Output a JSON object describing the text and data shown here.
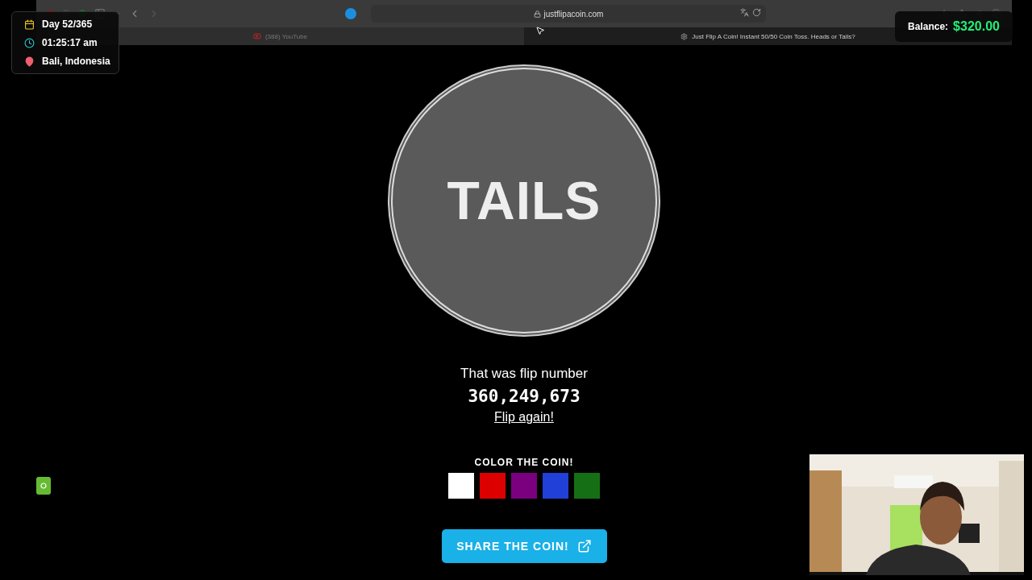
{
  "browser": {
    "url": "justflipacoin.com",
    "tabs": [
      {
        "title": "(388) YouTube",
        "selected": false
      },
      {
        "title": "Just Flip A Coin! Instant 50/50 Coin Toss. Heads or Tails?",
        "selected": true
      }
    ]
  },
  "coin": {
    "face": "TAILS"
  },
  "result": {
    "caption": "That was flip number",
    "number": "360,249,673",
    "link": "Flip again!"
  },
  "coin_colors": {
    "label": "COLOR THE COIN!",
    "swatches": [
      {
        "color": "#ffffff"
      },
      {
        "color": "#dd0000"
      },
      {
        "color": "#7a0080"
      },
      {
        "color": "#2040d8"
      },
      {
        "color": "#157015"
      }
    ]
  },
  "share_button": {
    "label": "SHARE THE COIN!"
  },
  "stream_overlay": {
    "stats": [
      {
        "kind": "day",
        "text": "Day 52/365"
      },
      {
        "kind": "time",
        "text": "01:25:17 am"
      },
      {
        "kind": "location",
        "text": "Bali, Indonesia"
      }
    ],
    "balance": {
      "label": "Balance:",
      "amount": "$320.00"
    }
  }
}
